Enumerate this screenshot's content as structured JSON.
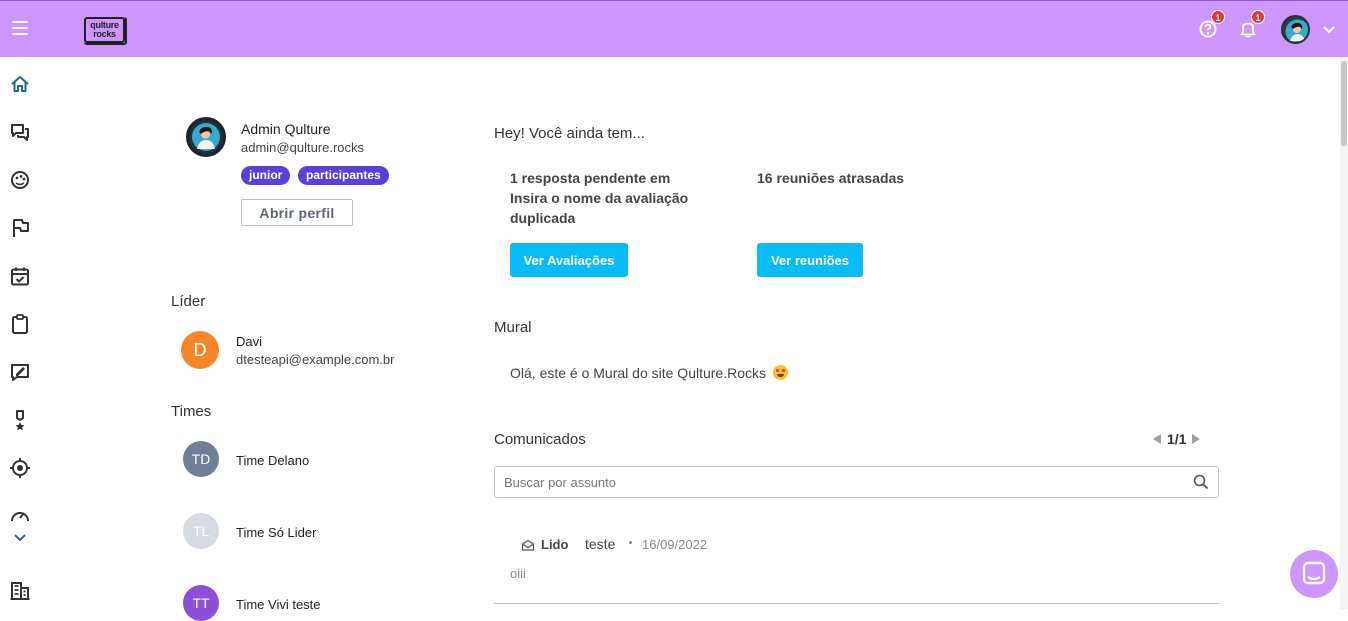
{
  "topbar": {
    "logo_line1": "qulture",
    "logo_line2": "rocks",
    "help_badge": "1",
    "notif_badge": "1"
  },
  "profile": {
    "name": "Admin Qulture",
    "email": "admin@qulture.rocks",
    "tags": [
      "junior",
      "participantes"
    ],
    "open_profile_label": "Abrir perfil"
  },
  "leader": {
    "section_title": "Líder",
    "initial": "D",
    "name": "Davi",
    "email": "dtesteapi@example.com.br"
  },
  "teams": {
    "section_title": "Times",
    "items": [
      {
        "initials": "TD",
        "name": "Time Delano",
        "color": "#6f7f95"
      },
      {
        "initials": "TL",
        "name": "Time Só Lider",
        "color": "#d5dae3"
      },
      {
        "initials": "TT",
        "name": "Time Vivi teste",
        "color": "#8b4fd8"
      }
    ]
  },
  "pending": {
    "title": "Hey! Você ainda tem...",
    "reviews_line1": "1 resposta pendente em",
    "reviews_line2": "Insira o nome da avaliação",
    "reviews_line3": "duplicada",
    "reviews_button": "Ver Avaliações",
    "meetings_text": "16 reuniões atrasadas",
    "meetings_button": "Ver reuniões"
  },
  "mural": {
    "title": "Mural",
    "message": "Olá, este é o Mural do site Qulture.Rocks"
  },
  "comunicados": {
    "title": "Comunicados",
    "pager": "1/1",
    "search_placeholder": "Buscar por assunto",
    "items": [
      {
        "status": "Lido",
        "subject": "teste",
        "date": "16/09/2022",
        "body": "oiii"
      }
    ]
  },
  "colors": {
    "topbar": "#cf95ff",
    "tag": "#5b3fd8",
    "primary_button": "#0bbbf5",
    "leader_avatar": "#f5862a"
  }
}
